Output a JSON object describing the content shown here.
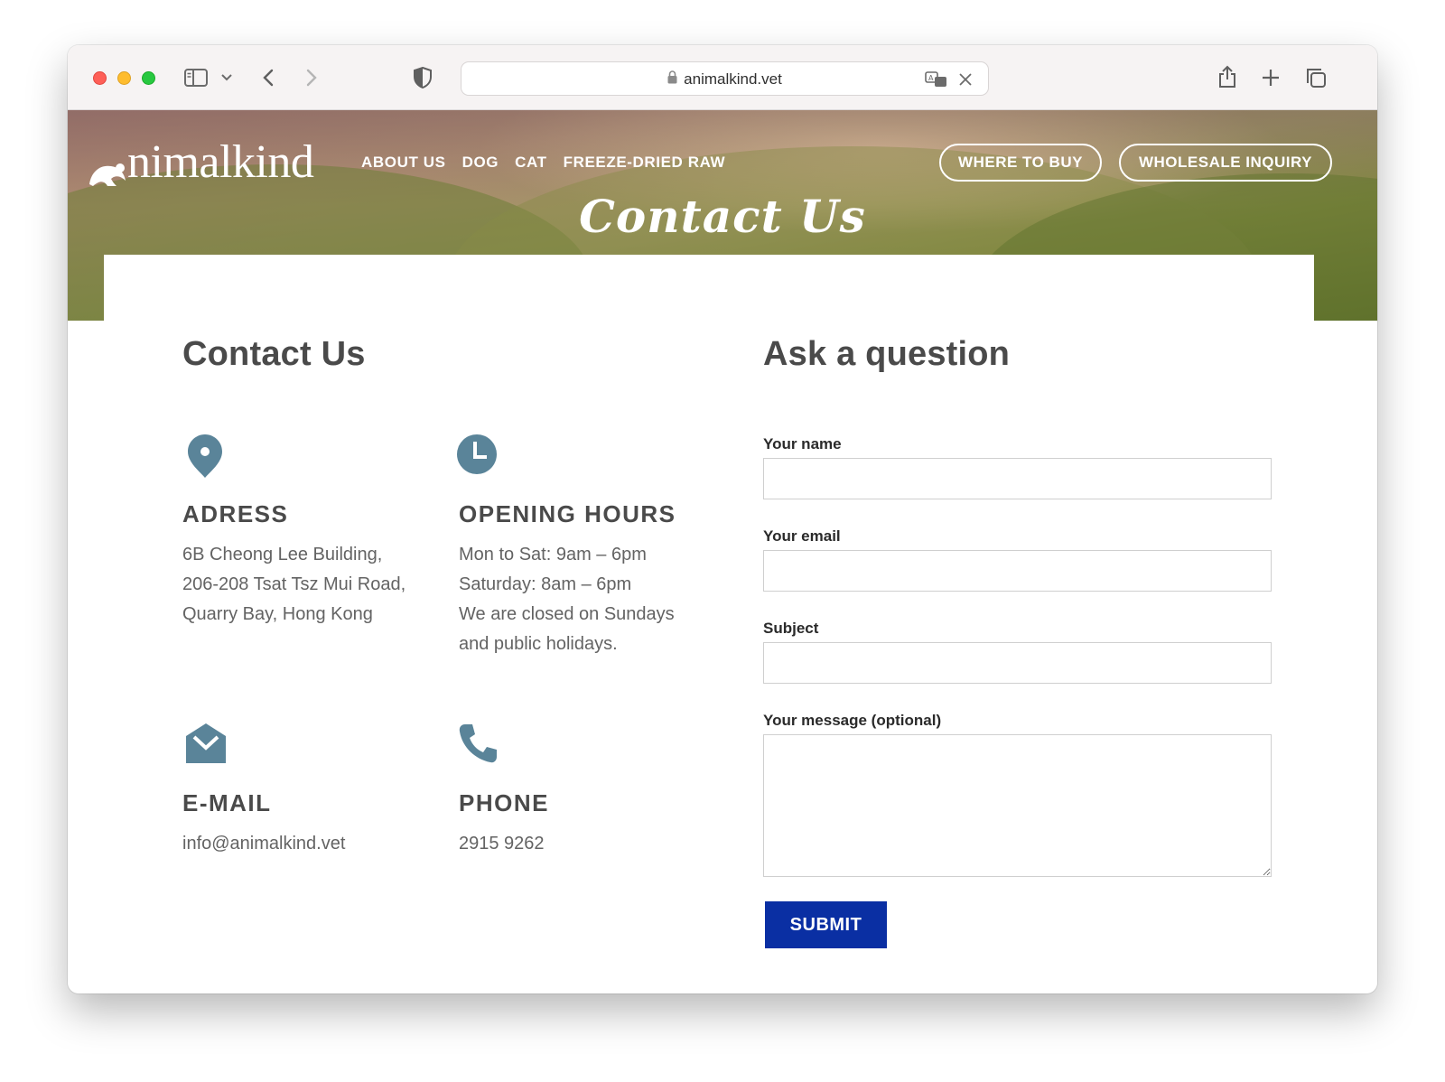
{
  "browser": {
    "url": "animalkind.vet"
  },
  "site": {
    "logo_text": "nimalkind",
    "nav": [
      "ABOUT US",
      "DOG",
      "CAT",
      "FREEZE-DRIED RAW"
    ],
    "where_to_buy": "WHERE TO BUY",
    "wholesale": "WHOLESALE INQUIRY",
    "hero_title": "Contact Us"
  },
  "contact": {
    "heading": "Contact Us",
    "address": {
      "title": "ADRESS",
      "lines": [
        "6B Cheong Lee Building,",
        "206-208 Tsat Tsz Mui Road,",
        "Quarry Bay, Hong Kong"
      ]
    },
    "hours": {
      "title": "OPENING HOURS",
      "lines": [
        "Mon to Sat: 9am – 6pm",
        "Saturday: 8am – 6pm",
        "We are closed on Sundays",
        "and public holidays."
      ]
    },
    "email": {
      "title": "E-MAIL",
      "value": "info@animalkind.vet"
    },
    "phone": {
      "title": "PHONE",
      "value": "2915 9262"
    }
  },
  "form": {
    "heading": "Ask a question",
    "name_label": "Your name",
    "email_label": "Your email",
    "subject_label": "Subject",
    "message_label": "Your message (optional)",
    "submit_label": "SUBMIT"
  },
  "colors": {
    "icon": "#5a8499",
    "submit_bg": "#0a2fa3",
    "heading": "#4a4a4a",
    "body_text": "#636363"
  }
}
